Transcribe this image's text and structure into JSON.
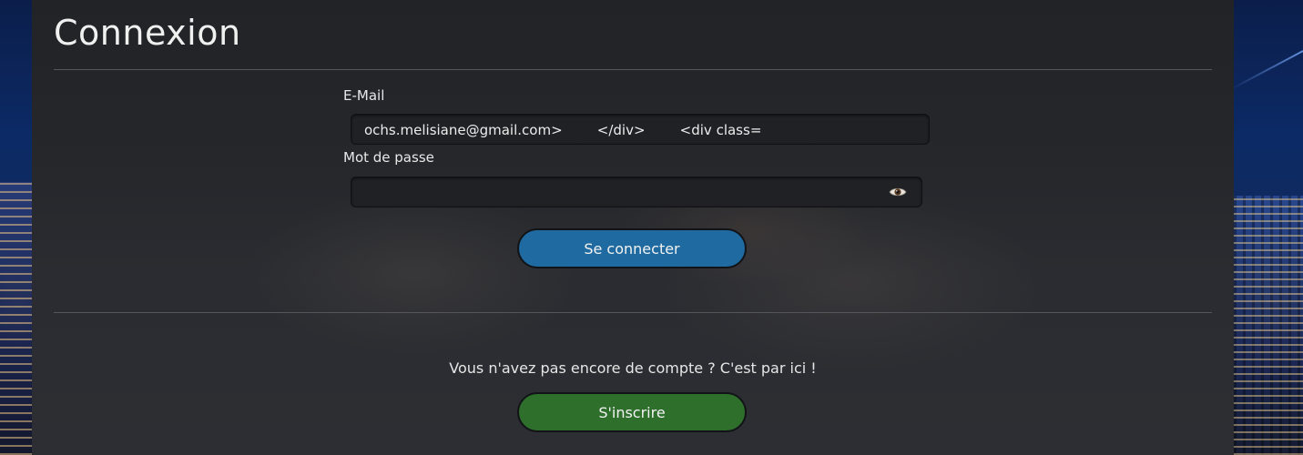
{
  "page": {
    "title": "Connexion"
  },
  "login_form": {
    "email_label": "E-Mail",
    "email_value": "ochs.melisiane@gmail.com>        </div>        <div class=",
    "password_label": "Mot de passe",
    "password_value": "",
    "password_toggle_icon": "eye-icon",
    "submit_label": "Se connecter"
  },
  "signup": {
    "prompt": "Vous n'avez pas encore de compte ? C'est par ici !",
    "button_label": "S'inscrire"
  },
  "colors": {
    "login_button": "#1f6aa0",
    "signup_button": "#2e6f2c",
    "panel": "#26272b"
  }
}
